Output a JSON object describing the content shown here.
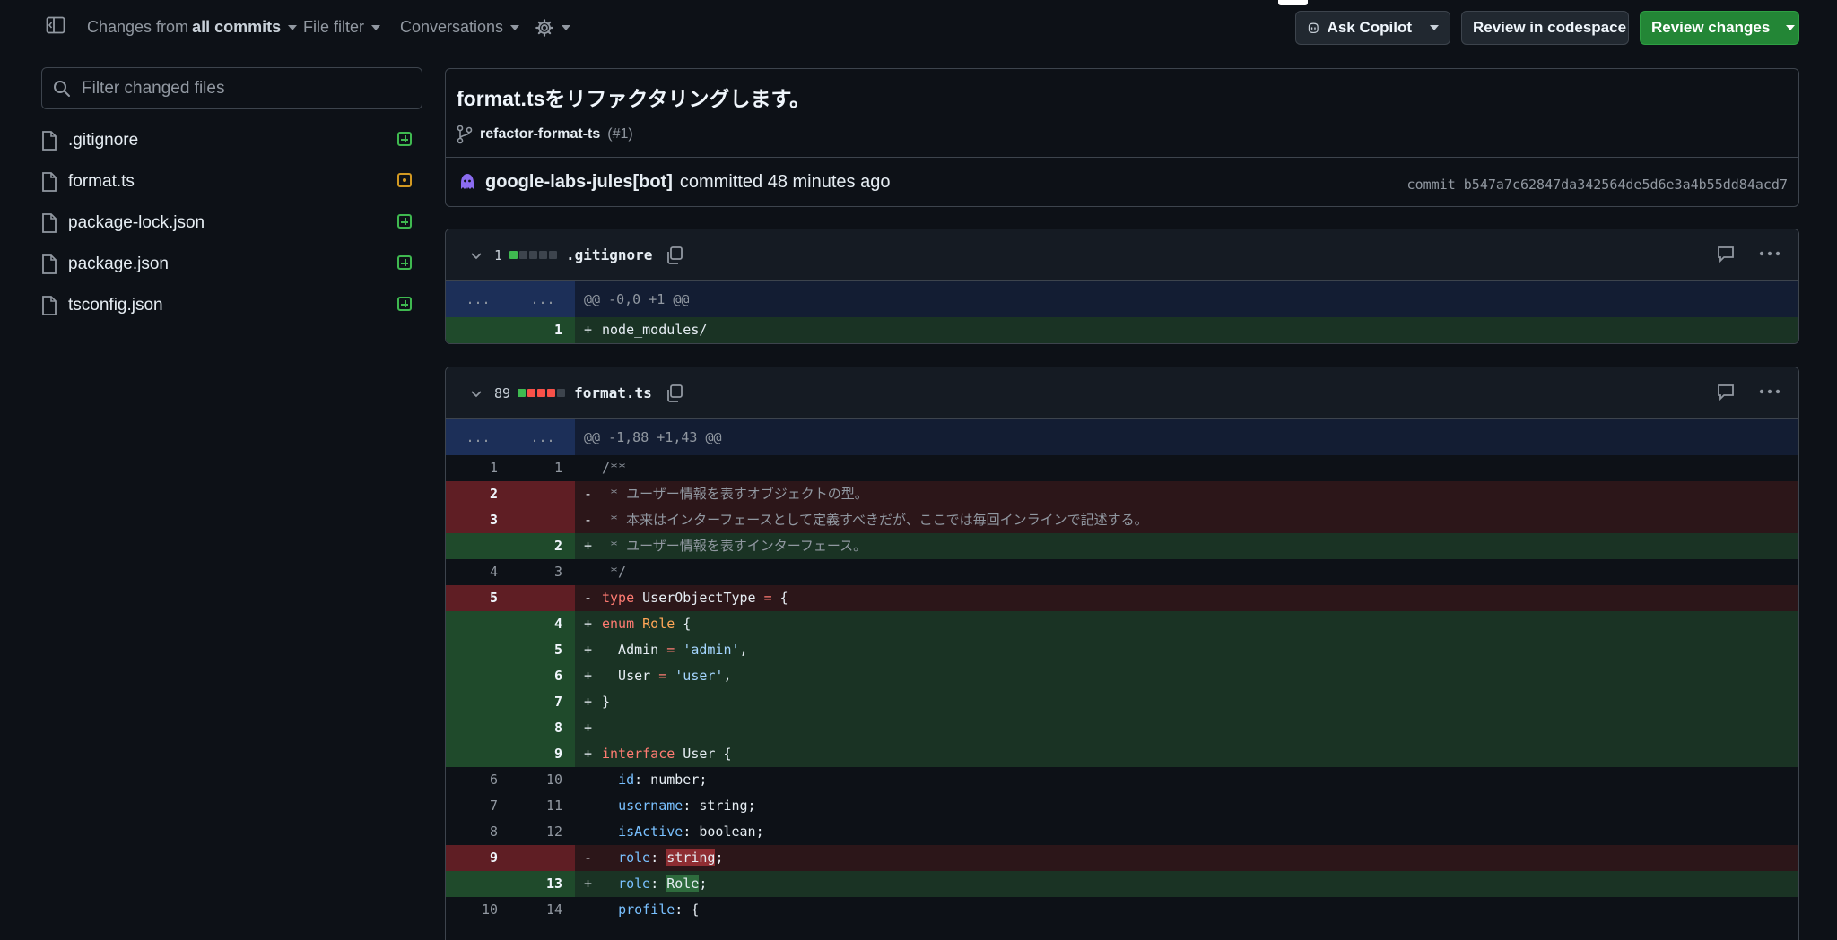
{
  "toolbar": {
    "changes_prefix": "Changes from",
    "changes_bold": "all commits",
    "file_filter": "File filter",
    "conversations": "Conversations",
    "ask_copilot": "Ask Copilot",
    "review_codespace": "Review in codespace",
    "review_changes": "Review changes"
  },
  "sidebar": {
    "filter_placeholder": "Filter changed files",
    "files": [
      {
        "name": ".gitignore",
        "status": "added"
      },
      {
        "name": "format.ts",
        "status": "modified"
      },
      {
        "name": "package-lock.json",
        "status": "added"
      },
      {
        "name": "package.json",
        "status": "added"
      },
      {
        "name": "tsconfig.json",
        "status": "added"
      }
    ]
  },
  "commit": {
    "title": "format.tsをリファクタリングします。",
    "branch": "refactor-format-ts",
    "pr": "(#1)",
    "author": "google-labs-jules[bot]",
    "action": "committed 48 minutes ago",
    "sha": "commit b547a7c62847da342564de5d6e3a4b55dd84acd7"
  },
  "diffs": [
    {
      "count": "1",
      "blocks": [
        "add",
        "neu",
        "neu",
        "neu",
        "neu"
      ],
      "filename": ".gitignore",
      "lines": [
        {
          "type": "hunk",
          "old": "...",
          "new": "...",
          "text": "@@ -0,0 +1 @@"
        },
        {
          "type": "add",
          "old": "",
          "new": "1",
          "text": "node_modules/"
        }
      ]
    },
    {
      "count": "89",
      "blocks": [
        "add",
        "del",
        "del",
        "del",
        "neu"
      ],
      "filename": "format.ts",
      "lines": [
        {
          "type": "hunk",
          "old": "...",
          "new": "...",
          "text": "@@ -1,88 +1,43 @@"
        },
        {
          "type": "ctx",
          "old": "1",
          "new": "1",
          "text": "/**"
        },
        {
          "type": "del",
          "old": "2",
          "new": "",
          "text": " * ユーザー情報を表すオブジェクトの型。"
        },
        {
          "type": "del",
          "old": "3",
          "new": "",
          "text": " * 本来はインターフェースとして定義すべきだが、ここでは毎回インラインで記述する。"
        },
        {
          "type": "add",
          "old": "",
          "new": "2",
          "text": " * ユーザー情報を表すインターフェース。"
        },
        {
          "type": "ctx",
          "old": "4",
          "new": "3",
          "text": " */"
        },
        {
          "type": "del",
          "old": "5",
          "new": "",
          "text": "type UserObjectType = {"
        },
        {
          "type": "add",
          "old": "",
          "new": "4",
          "text": "enum Role {"
        },
        {
          "type": "add",
          "old": "",
          "new": "5",
          "text": "  Admin = 'admin',"
        },
        {
          "type": "add",
          "old": "",
          "new": "6",
          "text": "  User = 'user',"
        },
        {
          "type": "add",
          "old": "",
          "new": "7",
          "text": "}"
        },
        {
          "type": "add",
          "old": "",
          "new": "8",
          "text": ""
        },
        {
          "type": "add",
          "old": "",
          "new": "9",
          "text": "interface User {"
        },
        {
          "type": "ctx",
          "old": "6",
          "new": "10",
          "text": "  id: number;"
        },
        {
          "type": "ctx",
          "old": "7",
          "new": "11",
          "text": "  username: string;"
        },
        {
          "type": "ctx",
          "old": "8",
          "new": "12",
          "text": "  isActive: boolean;"
        },
        {
          "type": "del",
          "old": "9",
          "new": "",
          "text": "  role: string;"
        },
        {
          "type": "add",
          "old": "",
          "new": "13",
          "text": "  role: Role;"
        },
        {
          "type": "ctx",
          "old": "10",
          "new": "14",
          "text": "  profile: {"
        }
      ]
    }
  ]
}
